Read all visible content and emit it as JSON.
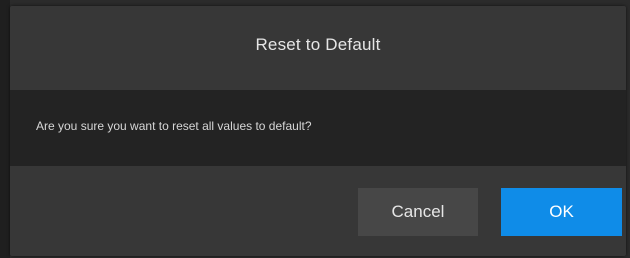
{
  "dialog": {
    "title": "Reset to Default",
    "message": "Are you sure you want to reset all values to default?",
    "buttons": {
      "cancel_label": "Cancel",
      "ok_label": "OK"
    }
  },
  "colors": {
    "accent": "#0f8ce8",
    "dialog_background": "#373737",
    "body_background": "#232323",
    "cancel_button": "#474747"
  }
}
